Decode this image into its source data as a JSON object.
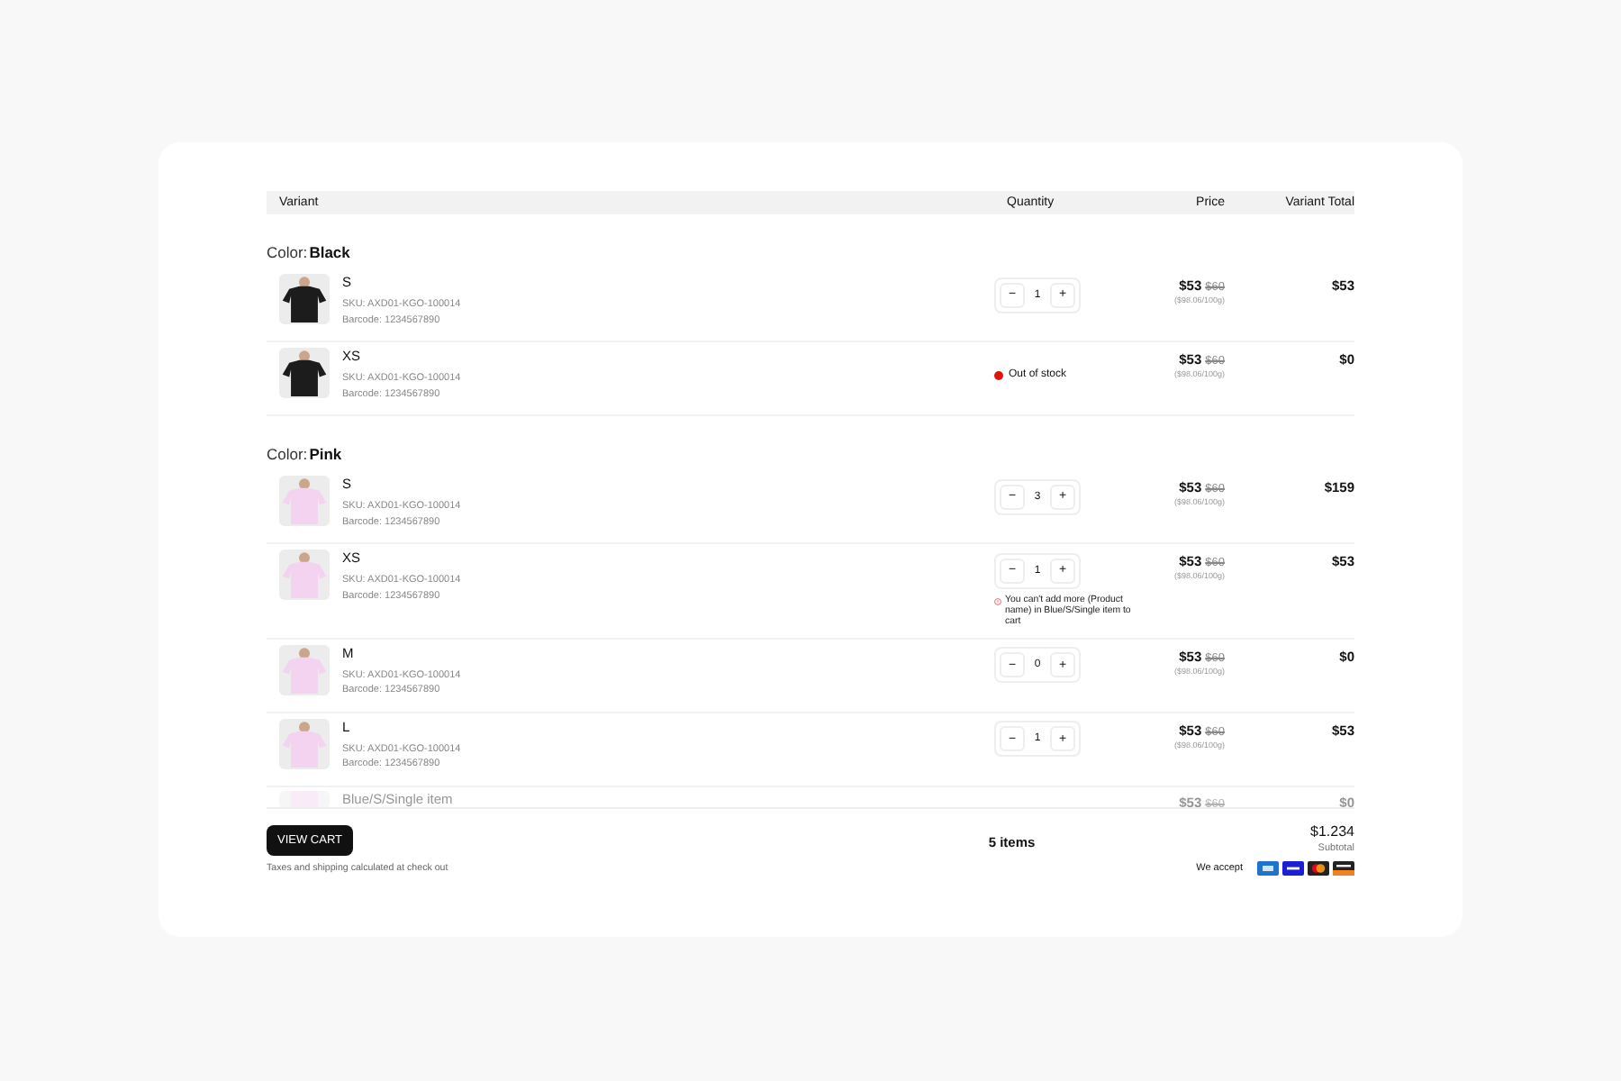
{
  "table": {
    "columns": [
      "Variant",
      "Quantity",
      "Price",
      "Variant Total"
    ],
    "groups": [
      {
        "label": "Color:",
        "value": "Black",
        "color": "#1c1c1c",
        "rows": [
          {
            "kind": "stepper",
            "size": "S",
            "sku": "SKU: AXD01-KGO-100014",
            "barcode": "Barcode: 1234567890",
            "quantity": "1",
            "minus": "−",
            "plus": "+",
            "price": "$53",
            "compare_price": "$60",
            "unit_price": "($98.06/100g)",
            "total": "$53"
          },
          {
            "kind": "out_of_stock",
            "size": "XS",
            "sku": "SKU: AXD01-KGO-100014",
            "barcode": "Barcode: 1234567890",
            "status": "Out of stock",
            "color": "#e0140f",
            "price": "$53",
            "compare_price": "$60",
            "unit_price": "($98.06/100g)",
            "total": "$0"
          }
        ]
      },
      {
        "label": "Color:",
        "value": "Pink",
        "color": "#f3d3f0",
        "rows": [
          {
            "kind": "stepper",
            "size": "S",
            "sku": "SKU: AXD01-KGO-100014",
            "barcode": "Barcode: 1234567890",
            "quantity": "3",
            "minus": "−",
            "plus": "+",
            "price": "$53",
            "compare_price": "$60",
            "unit_price": "($98.06/100g)",
            "total": "$159"
          },
          {
            "kind": "stepper",
            "size": "XS",
            "sku": "SKU: AXD01-KGO-100014",
            "barcode": "Barcode: 1234567890",
            "quantity": "1",
            "minus": "−",
            "plus": "+",
            "error": "You can't add more (Product name) in Blue/S/Single item to cart",
            "price": "$53",
            "compare_price": "$60",
            "unit_price": "($98.06/100g)",
            "total": "$53"
          },
          {
            "kind": "stepper",
            "size": "M",
            "sku": "SKU: AXD01-KGO-100014",
            "barcode": "Barcode: 1234567890",
            "quantity": "0",
            "minus": "−",
            "plus": "+",
            "price": "$53",
            "compare_price": "$60",
            "unit_price": "($98.06/100g)",
            "total": "$0"
          },
          {
            "kind": "stepper",
            "size": "L",
            "sku": "SKU: AXD01-KGO-100014",
            "barcode": "Barcode: 1234567890",
            "quantity": "1",
            "minus": "−",
            "plus": "+",
            "price": "$53",
            "compare_price": "$60",
            "unit_price": "($98.06/100g)",
            "total": "$53"
          },
          {
            "kind": "faded",
            "size": "Blue/S/Single item",
            "price": "$53",
            "compare_price": "$60",
            "total": "$0"
          }
        ]
      }
    ]
  },
  "footer": {
    "button": "VIEW CART",
    "items": "5 items",
    "subtotal": "$1.234",
    "subtotal_label": "Subtotal",
    "note": "Taxes and shipping calculated at check out",
    "accept_label": "We accept",
    "cards": [
      {
        "kind": "amex"
      },
      {
        "kind": "visa"
      },
      {
        "kind": "mastercard"
      },
      {
        "kind": "discover"
      }
    ]
  }
}
